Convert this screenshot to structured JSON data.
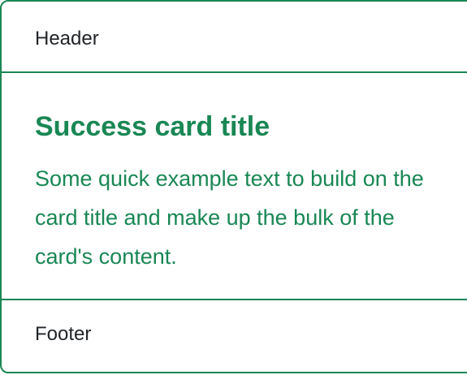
{
  "theme": {
    "accent": "#198754",
    "text_dark": "#212529",
    "background": "#ffffff"
  },
  "card": {
    "header": "Header",
    "title": "Success card title",
    "text": "Some quick example text to build on the card title and make up the bulk of the card's content.",
    "footer": "Footer"
  }
}
